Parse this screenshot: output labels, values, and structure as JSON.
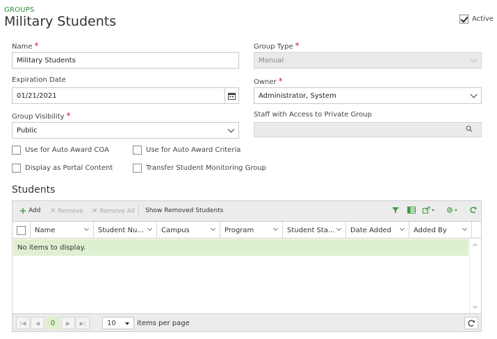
{
  "header": {
    "eyebrow": "GROUPS",
    "title": "Military Students",
    "active_label": "Active",
    "active_checked": true
  },
  "form": {
    "name": {
      "label": "Name",
      "value": "Military Students",
      "required": true
    },
    "group_type": {
      "label": "Group Type",
      "value": "Manual",
      "required": true
    },
    "expiration_date": {
      "label": "Expiration Date",
      "value": "01/21/2021"
    },
    "owner": {
      "label": "Owner",
      "value": "Administrator, System",
      "required": true
    },
    "group_visibility": {
      "label": "Group Visibility",
      "value": "Public",
      "required": true
    },
    "staff_access": {
      "label": "Staff with Access to Private Group",
      "value": ""
    },
    "checkboxes": {
      "auto_award_coa": "Use for Auto Award COA",
      "auto_award_criteria": "Use for Auto Award Criteria",
      "portal_content": "Display as Portal Content",
      "transfer_monitoring": "Transfer Student Monitoring Group"
    },
    "required_mark": "*"
  },
  "students": {
    "title": "Students",
    "toolbar": {
      "add": "Add",
      "remove": "Remove",
      "remove_all": "Remove All",
      "show_removed": "Show Removed Students"
    },
    "columns": [
      "Name",
      "Student Nu...",
      "Campus",
      "Program",
      "Student Sta...",
      "Date Added",
      "Added By"
    ],
    "empty_text": "No items to display.",
    "pager": {
      "current_page": "0",
      "page_size": "10",
      "items_per_page_label": "items per page"
    }
  },
  "colors": {
    "accent_green": "#2e8b3a",
    "required_red": "#d0202e",
    "empty_row_bg": "#dff0d0"
  }
}
